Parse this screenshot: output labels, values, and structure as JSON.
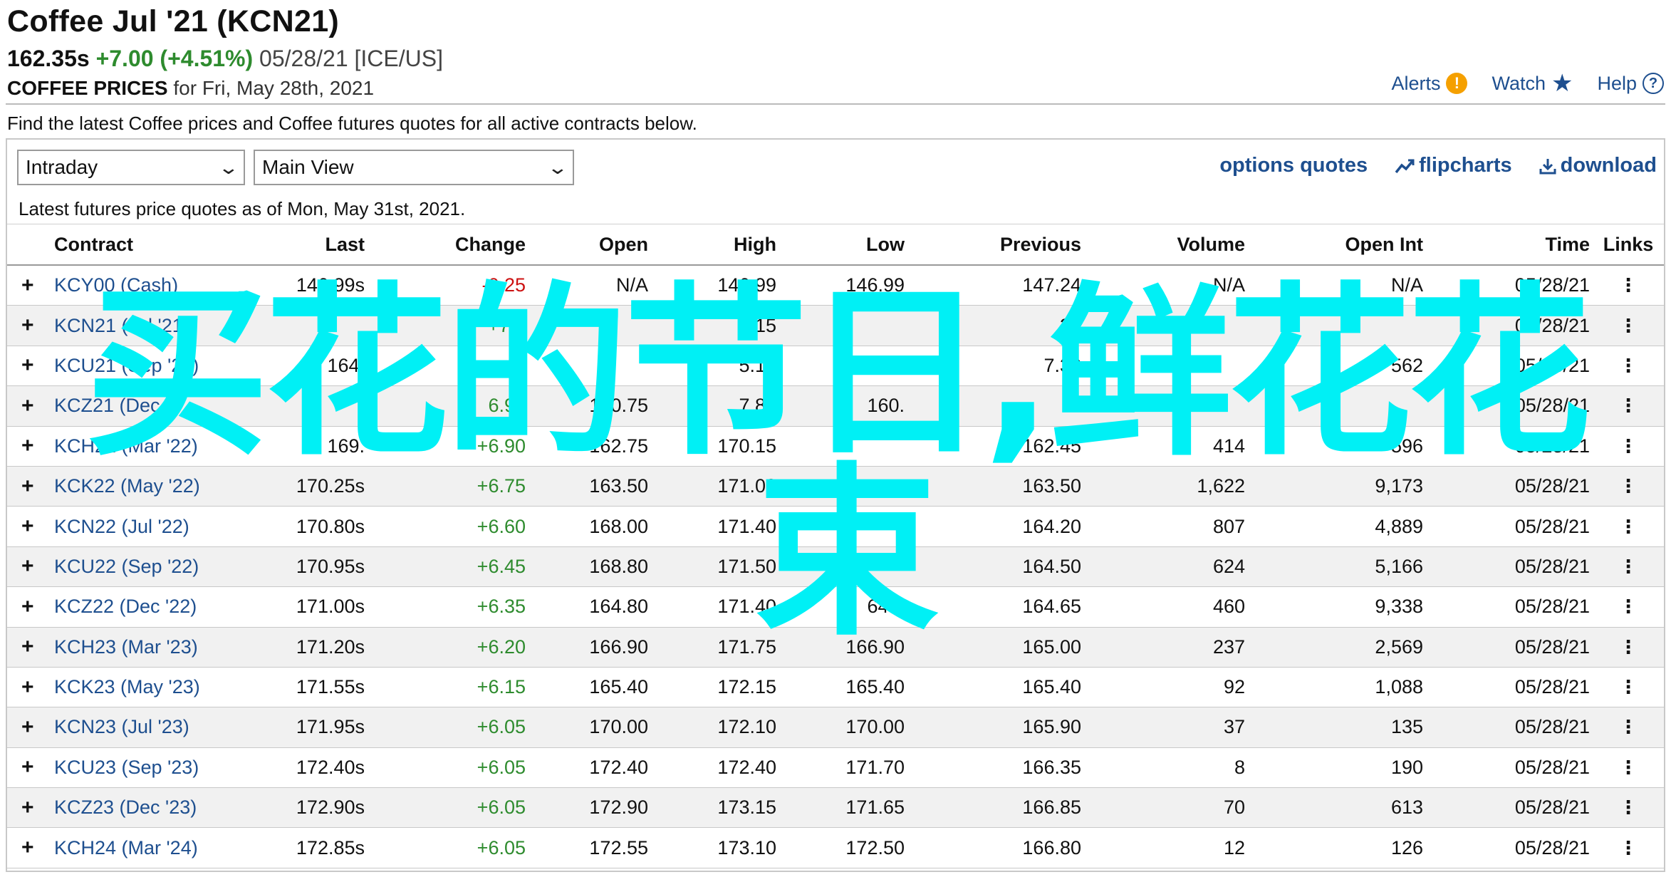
{
  "header": {
    "title": "Coffee Jul '21 (KCN21)",
    "last": "162.35s",
    "change": "+7.00 (+4.51%)",
    "meta": "05/28/21 [ICE/US]",
    "prices_label": "COFFEE PRICES",
    "prices_date": " for Fri, May 28th, 2021"
  },
  "top_links": {
    "alerts": "Alerts",
    "watch": "Watch",
    "help": "Help"
  },
  "intro_text": "Find the latest Coffee prices and Coffee futures quotes for all active contracts below.",
  "controls": {
    "period": "Intraday",
    "view": "Main View",
    "options_quotes": "options quotes",
    "flipcharts": "flipcharts",
    "download": "download"
  },
  "latest_text": "Latest futures price quotes as of Mon, May 31st, 2021.",
  "table": {
    "headers": {
      "contract": "Contract",
      "last": "Last",
      "change": "Change",
      "open": "Open",
      "high": "High",
      "low": "Low",
      "previous": "Previous",
      "volume": "Volume",
      "open_int": "Open Int",
      "time": "Time",
      "links": "Links"
    },
    "rows": [
      {
        "contract": "KCY00 (Cash)",
        "last": "146.99s",
        "change": "-0.25",
        "open": "N/A",
        "high": "146.99",
        "low": "146.99",
        "previous": "147.24",
        "volume": "N/A",
        "open_int": "N/A",
        "time": "05/28/21"
      },
      {
        "contract": "KCN21 (Jul '21)",
        "last": "",
        "change": "+7.0",
        "open": "",
        "high": "15",
        "low": "",
        "previous": "35",
        "volume": "",
        "open_int": "",
        "time": "05/28/21"
      },
      {
        "contract": "KCU21 (Sep '21)",
        "last": "164.",
        "change": "",
        "open": "",
        "high": "5.10",
        "low": "",
        "previous": "7.30",
        "volume": "",
        "open_int": "562",
        "time": "05/28/21"
      },
      {
        "contract": "KCZ21 (Dec",
        "last": "",
        "change": "6.90",
        "open": "160.75",
        "high": "7.85",
        "low": "160.",
        "previous": "",
        "volume": "",
        "open_int": "",
        "time": "05/28/21"
      },
      {
        "contract": "KCH22 (Mar '22)",
        "last": "169.",
        "change": "+6.90",
        "open": "162.75",
        "high": "170.15",
        "low": "",
        "previous": "162.45",
        "volume": "414",
        "open_int": "596",
        "time": "05/28/21"
      },
      {
        "contract": "KCK22 (May '22)",
        "last": "170.25s",
        "change": "+6.75",
        "open": "163.50",
        "high": "171.00",
        "low": "",
        "previous": "163.50",
        "volume": "1,622",
        "open_int": "9,173",
        "time": "05/28/21"
      },
      {
        "contract": "KCN22 (Jul '22)",
        "last": "170.80s",
        "change": "+6.60",
        "open": "168.00",
        "high": "171.40",
        "low": "",
        "previous": "164.20",
        "volume": "807",
        "open_int": "4,889",
        "time": "05/28/21"
      },
      {
        "contract": "KCU22 (Sep '22)",
        "last": "170.95s",
        "change": "+6.45",
        "open": "168.80",
        "high": "171.50",
        "low": "",
        "previous": "164.50",
        "volume": "624",
        "open_int": "5,166",
        "time": "05/28/21"
      },
      {
        "contract": "KCZ22 (Dec '22)",
        "last": "171.00s",
        "change": "+6.35",
        "open": "164.80",
        "high": "171.40",
        "low": "64.8",
        "previous": "164.65",
        "volume": "460",
        "open_int": "9,338",
        "time": "05/28/21"
      },
      {
        "contract": "KCH23 (Mar '23)",
        "last": "171.20s",
        "change": "+6.20",
        "open": "166.90",
        "high": "171.75",
        "low": "166.90",
        "previous": "165.00",
        "volume": "237",
        "open_int": "2,569",
        "time": "05/28/21"
      },
      {
        "contract": "KCK23 (May '23)",
        "last": "171.55s",
        "change": "+6.15",
        "open": "165.40",
        "high": "172.15",
        "low": "165.40",
        "previous": "165.40",
        "volume": "92",
        "open_int": "1,088",
        "time": "05/28/21"
      },
      {
        "contract": "KCN23 (Jul '23)",
        "last": "171.95s",
        "change": "+6.05",
        "open": "170.00",
        "high": "172.10",
        "low": "170.00",
        "previous": "165.90",
        "volume": "37",
        "open_int": "135",
        "time": "05/28/21"
      },
      {
        "contract": "KCU23 (Sep '23)",
        "last": "172.40s",
        "change": "+6.05",
        "open": "172.40",
        "high": "172.40",
        "low": "171.70",
        "previous": "166.35",
        "volume": "8",
        "open_int": "190",
        "time": "05/28/21"
      },
      {
        "contract": "KCZ23 (Dec '23)",
        "last": "172.90s",
        "change": "+6.05",
        "open": "172.90",
        "high": "173.15",
        "low": "171.65",
        "previous": "166.85",
        "volume": "70",
        "open_int": "613",
        "time": "05/28/21"
      },
      {
        "contract": "KCH24 (Mar '24)",
        "last": "172.85s",
        "change": "+6.05",
        "open": "172.55",
        "high": "173.10",
        "low": "172.50",
        "previous": "166.80",
        "volume": "12",
        "open_int": "126",
        "time": "05/28/21"
      }
    ]
  },
  "overlay": {
    "line1": "买花的节日,鲜花花",
    "line2": "束",
    "color": "#00f0f5"
  },
  "colors": {
    "link": "#1e4f8f",
    "positive": "#2e8b2e",
    "negative": "#cc1111",
    "alert": "#f5a000"
  },
  "icons": {
    "alerts": "exclamation-circle-icon",
    "watch": "star-icon",
    "help": "question-circle-icon",
    "row_expand": "plus-icon",
    "row_links": "vertical-ellipsis-icon"
  }
}
